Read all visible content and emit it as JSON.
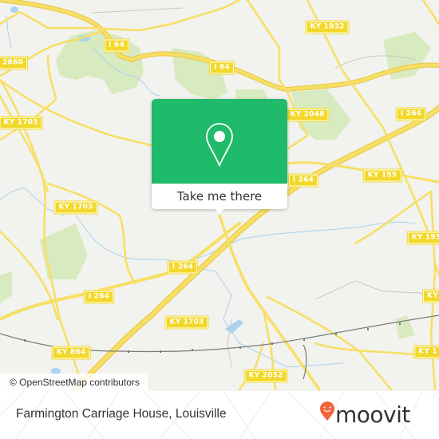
{
  "map": {
    "colors": {
      "background": "#f2f2ee",
      "road": "#f7df63",
      "road_casing": "#e8c94a",
      "park": "#d8eabf",
      "water": "#a9d3ef",
      "rail": "#777777",
      "shield_bg": "#f2d829"
    },
    "road_labels": [
      {
        "id": "i64-a",
        "text": "I 64"
      },
      {
        "id": "i64-b",
        "text": "I 64"
      },
      {
        "id": "ky1932-top",
        "text": "KY 1932"
      },
      {
        "id": "ky2860",
        "text": "2860"
      },
      {
        "id": "ky1703-a",
        "text": "KY 1703"
      },
      {
        "id": "ky2048",
        "text": "KY 2048"
      },
      {
        "id": "i264-a",
        "text": "I 264"
      },
      {
        "id": "i264-b",
        "text": "I 264"
      },
      {
        "id": "ky155",
        "text": "KY 155"
      },
      {
        "id": "ky1703-b",
        "text": "KY 1703"
      },
      {
        "id": "ky193-right",
        "text": "KY 193"
      },
      {
        "id": "i264-c",
        "text": "I 264"
      },
      {
        "id": "i264-d",
        "text": "I 264"
      },
      {
        "id": "ky-right-mid",
        "text": "KY"
      },
      {
        "id": "ky1703-c",
        "text": "KY 1703"
      },
      {
        "id": "ky864",
        "text": "KY 864"
      },
      {
        "id": "ky1-right-low",
        "text": "KY 1"
      },
      {
        "id": "ky2052",
        "text": "KY 2052"
      }
    ],
    "attribution": "© OpenStreetMap contributors"
  },
  "popup": {
    "icon": "location-pin-icon",
    "accent": "#1fba6a",
    "button_label": "Take me there"
  },
  "footer": {
    "place_name": "Farmington Carriage House, Louisville",
    "brand": "moovit",
    "brand_icon": "moovit-pin-icon",
    "brand_color": "#f4643c"
  }
}
